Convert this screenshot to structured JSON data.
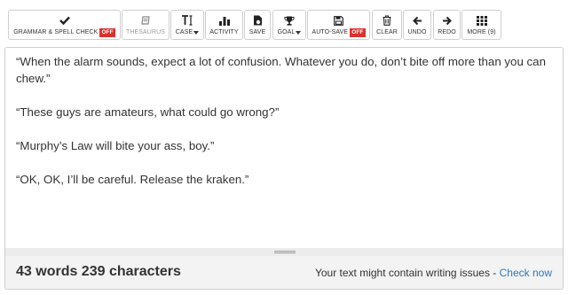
{
  "toolbar": {
    "buttons": [
      {
        "label": "GRAMMAR & SPELL CHECK",
        "badge": "OFF",
        "icon": "checkmark-icon"
      },
      {
        "label": "THESAURUS",
        "icon": "book-icon",
        "disabled": true
      },
      {
        "label": "CASE",
        "icon": "text-case-icon",
        "dropdown": true
      },
      {
        "label": "ACTIVITY",
        "icon": "bar-chart-icon"
      },
      {
        "label": "SAVE",
        "icon": "save-file-icon"
      },
      {
        "label": "GOAL",
        "icon": "trophy-icon",
        "dropdown": true
      },
      {
        "label": "AUTO-SAVE",
        "badge": "OFF",
        "icon": "floppy-disk-icon"
      },
      {
        "label": "CLEAR",
        "icon": "trash-icon"
      },
      {
        "label": "UNDO",
        "icon": "arrow-left-icon"
      },
      {
        "label": "REDO",
        "icon": "arrow-right-icon"
      },
      {
        "label": "MORE (9)",
        "icon": "grid-icon"
      }
    ]
  },
  "editor": {
    "paragraphs": [
      "“When the alarm sounds, expect a lot of confusion. Whatever you do, don’t bite off more than you can chew.”",
      "“These guys are amateurs, what could go wrong?”",
      "“Murphy’s Law will bite your ass, boy.”",
      "“OK, OK, I’ll be careful. Release the kraken.”"
    ]
  },
  "status": {
    "counts": "43 words 239 characters",
    "issues_text": "Your text might contain writing issues - ",
    "check_link": "Check now"
  },
  "colors": {
    "badge_off": "#d9322d",
    "link": "#2a7ab8",
    "status_bg": "#f3f3f3"
  }
}
